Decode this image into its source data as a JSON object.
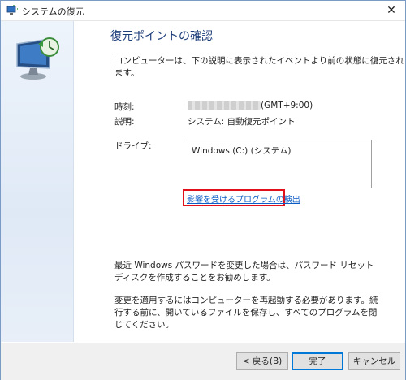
{
  "window": {
    "title": "システムの復元",
    "close_label": "✕"
  },
  "main": {
    "title": "復元ポイントの確認",
    "description": "コンピューターは、下の説明に表示されたイベントより前の状態に復元されます。",
    "time_label": "時刻:",
    "time_timezone": "(GMT+9:00)",
    "desc_label": "説明:",
    "desc_value": "システム: 自動復元ポイント",
    "drive_label": "ドライブ:",
    "drives": [
      "Windows (C:) (システム)"
    ],
    "affected_link": "影響を受けるプログラムの検出",
    "password_note": "最近 Windows パスワードを変更した場合は、パスワード リセット ディスクを作成することをお勧めします。",
    "restart_note": "変更を適用するにはコンピューターを再起動する必要があります。続行する前に、開いているファイルを保存し、すべてのプログラムを閉じてください。"
  },
  "buttons": {
    "back": "< 戻る(B)",
    "finish": "完了",
    "cancel": "キャンセル"
  },
  "colors": {
    "title_blue": "#1c3d7a",
    "link_blue": "#0b5cc4",
    "highlight_red": "#e3101b"
  }
}
